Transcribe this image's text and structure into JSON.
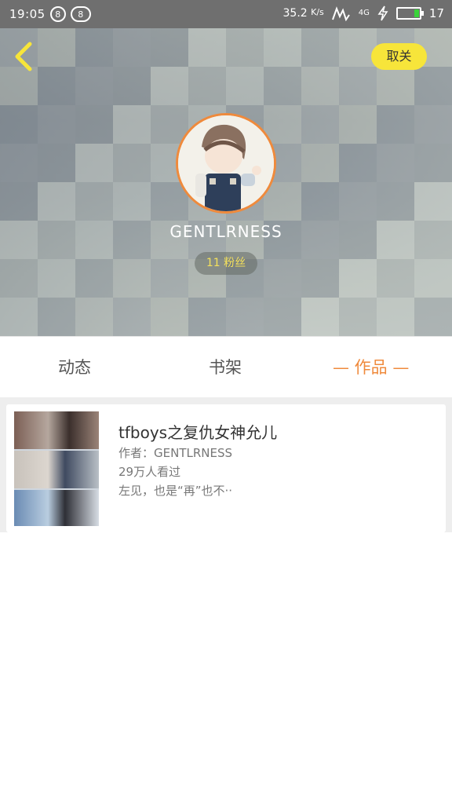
{
  "status_bar": {
    "time": "19:05",
    "speed_value": "35.2",
    "speed_unit": "K/s",
    "network": "4G",
    "battery_text": "17",
    "battery_level_percent": 17,
    "battery_color": "#3ad33a"
  },
  "header": {
    "follow_label": "取关",
    "username": "GENTLRNESS",
    "fans_text": "11 粉丝",
    "accent_color": "#ef8a3c",
    "button_color": "#f7e53a"
  },
  "tabs": [
    {
      "label": "动态",
      "active": false
    },
    {
      "label": "书架",
      "active": false
    },
    {
      "label": "— 作品 —",
      "active": true
    }
  ],
  "works": [
    {
      "title": "tfboys之复仇女神允儿",
      "author_line": "作者：GENTLRNESS",
      "views_line": "29万人看过",
      "excerpt": "左见，也是“再”也不··"
    }
  ]
}
